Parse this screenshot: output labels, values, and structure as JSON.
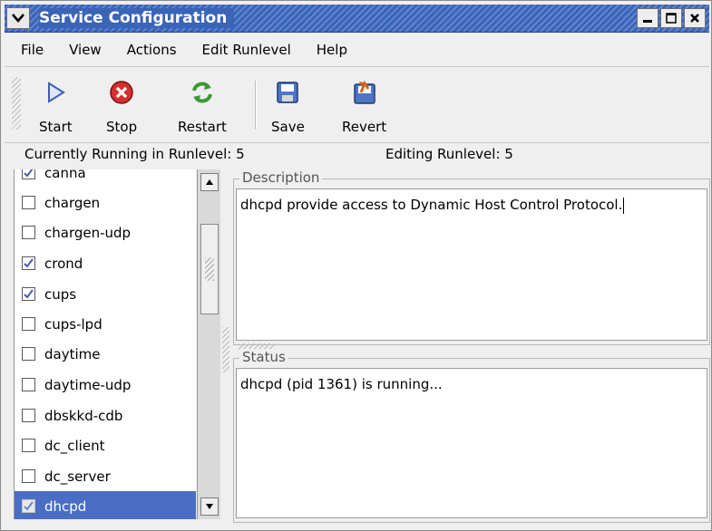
{
  "window": {
    "title": "Service Configuration"
  },
  "menu": [
    "File",
    "View",
    "Actions",
    "Edit Runlevel",
    "Help"
  ],
  "toolbar": {
    "start": "Start",
    "stop": "Stop",
    "restart": "Restart",
    "save": "Save",
    "revert": "Revert"
  },
  "status_strip": {
    "running": "Currently Running in Runlevel: 5",
    "editing": "Editing Runlevel: 5"
  },
  "services": [
    {
      "name": "canna",
      "checked": true
    },
    {
      "name": "chargen",
      "checked": false
    },
    {
      "name": "chargen-udp",
      "checked": false
    },
    {
      "name": "crond",
      "checked": true
    },
    {
      "name": "cups",
      "checked": true
    },
    {
      "name": "cups-lpd",
      "checked": false
    },
    {
      "name": "daytime",
      "checked": false
    },
    {
      "name": "daytime-udp",
      "checked": false
    },
    {
      "name": "dbskkd-cdb",
      "checked": false
    },
    {
      "name": "dc_client",
      "checked": false
    },
    {
      "name": "dc_server",
      "checked": false
    },
    {
      "name": "dhcpd",
      "checked": true,
      "selected": true
    }
  ],
  "description": {
    "label": "Description",
    "text": "dhcpd provide access to Dynamic Host Control Protocol."
  },
  "status": {
    "label": "Status",
    "text": "dhcpd (pid 1361) is running..."
  },
  "colors": {
    "titlebar": "#3a64b8",
    "selection": "#4a6ec3",
    "window_bg": "#efefef"
  }
}
